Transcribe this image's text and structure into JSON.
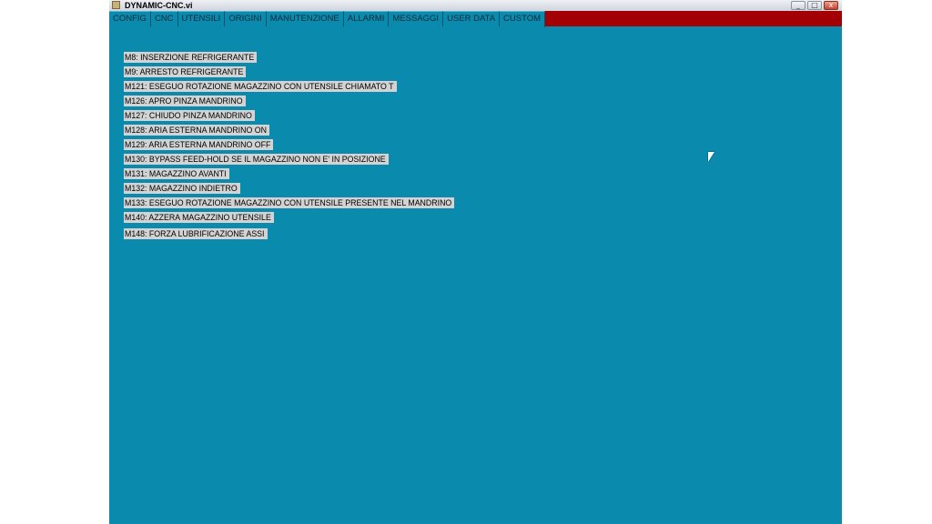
{
  "window": {
    "title": "DYNAMIC-CNC.vi",
    "controls": {
      "minimize": "_",
      "maximize": "□",
      "close": "x"
    }
  },
  "tabs": [
    {
      "label": "CONFIG",
      "active": false
    },
    {
      "label": "CNC",
      "active": false
    },
    {
      "label": "UTENSILI",
      "active": false
    },
    {
      "label": "ORIGINI",
      "active": false
    },
    {
      "label": "MANUTENZIONE",
      "active": false
    },
    {
      "label": "ALLARMI",
      "active": false
    },
    {
      "label": "MESSAGGI",
      "active": false
    },
    {
      "label": "USER DATA",
      "active": false
    },
    {
      "label": "CUSTOM",
      "active": true
    }
  ],
  "custom": {
    "items": [
      "M8: INSERZIONE REFRIGERANTE",
      "M9: ARRESTO REFRIGERANTE",
      "M121: ESEGUO ROTAZIONE MAGAZZINO CON UTENSILE CHIAMATO T",
      "M126: APRO PINZA MANDRINO",
      "M127: CHIUDO PINZA MANDRINO",
      "M128: ARIA ESTERNA MANDRINO ON",
      "M129: ARIA ESTERNA MANDRINO OFF",
      "M130: BYPASS FEED-HOLD SE IL MAGAZZINO NON E' IN POSIZIONE",
      "M131: MAGAZZINO AVANTI",
      "M132: MAGAZZINO INDIETRO",
      "M133: ESEGUO ROTAZIONE MAGAZZINO CON UTENSILE PRESENTE NEL MANDRINO",
      "M140: AZZERA MAGAZZINO UTENSILE",
      "M148: FORZA LUBRIFICAZIONE ASSI"
    ]
  },
  "colors": {
    "panel_background": "#0a8aad",
    "tabbar_background": "#a30006",
    "label_background": "#d3d3d3"
  }
}
